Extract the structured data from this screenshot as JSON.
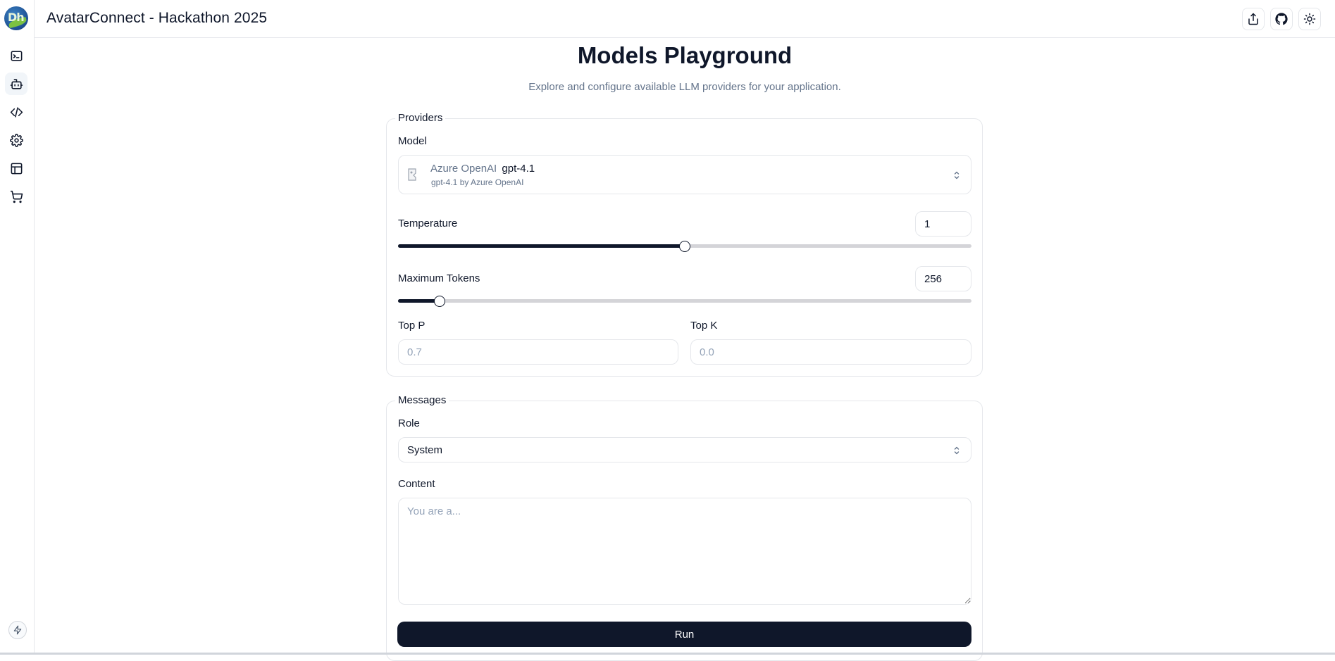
{
  "header": {
    "title": "AvatarConnect - Hackathon 2025",
    "buttons": [
      "share-icon",
      "github-icon",
      "sun-icon"
    ]
  },
  "sidebar": {
    "logo_text": "Dh",
    "items": [
      {
        "icon": "terminal-icon",
        "active": false
      },
      {
        "icon": "bot-icon",
        "active": true
      },
      {
        "icon": "code-icon",
        "active": false
      },
      {
        "icon": "settings-icon",
        "active": false
      },
      {
        "icon": "layout-icon",
        "active": false
      },
      {
        "icon": "cart-icon",
        "active": false
      }
    ],
    "footer_icon": "bolt-icon"
  },
  "main": {
    "title": "Models Playground",
    "subtitle": "Explore and configure available LLM providers for your application."
  },
  "providers": {
    "legend": "Providers",
    "model_label": "Model",
    "model": {
      "provider": "Azure OpenAI",
      "name": "gpt-4.1",
      "description": "gpt-4.1 by Azure OpenAI"
    },
    "temperature": {
      "label": "Temperature",
      "value": "1",
      "fraction": 0.5
    },
    "max_tokens": {
      "label": "Maximum Tokens",
      "value": "256",
      "fraction": 0.072
    },
    "top_p": {
      "label": "Top P",
      "placeholder": "0.7"
    },
    "top_k": {
      "label": "Top K",
      "placeholder": "0.0"
    }
  },
  "messages": {
    "legend": "Messages",
    "role_label": "Role",
    "role_value": "System",
    "content_label": "Content",
    "content_placeholder": "You are a...",
    "run_label": "Run"
  },
  "colors": {
    "primary": "#0f172a",
    "muted": "#64748b",
    "border": "#e5e7eb",
    "track": "#d4d4d8"
  }
}
